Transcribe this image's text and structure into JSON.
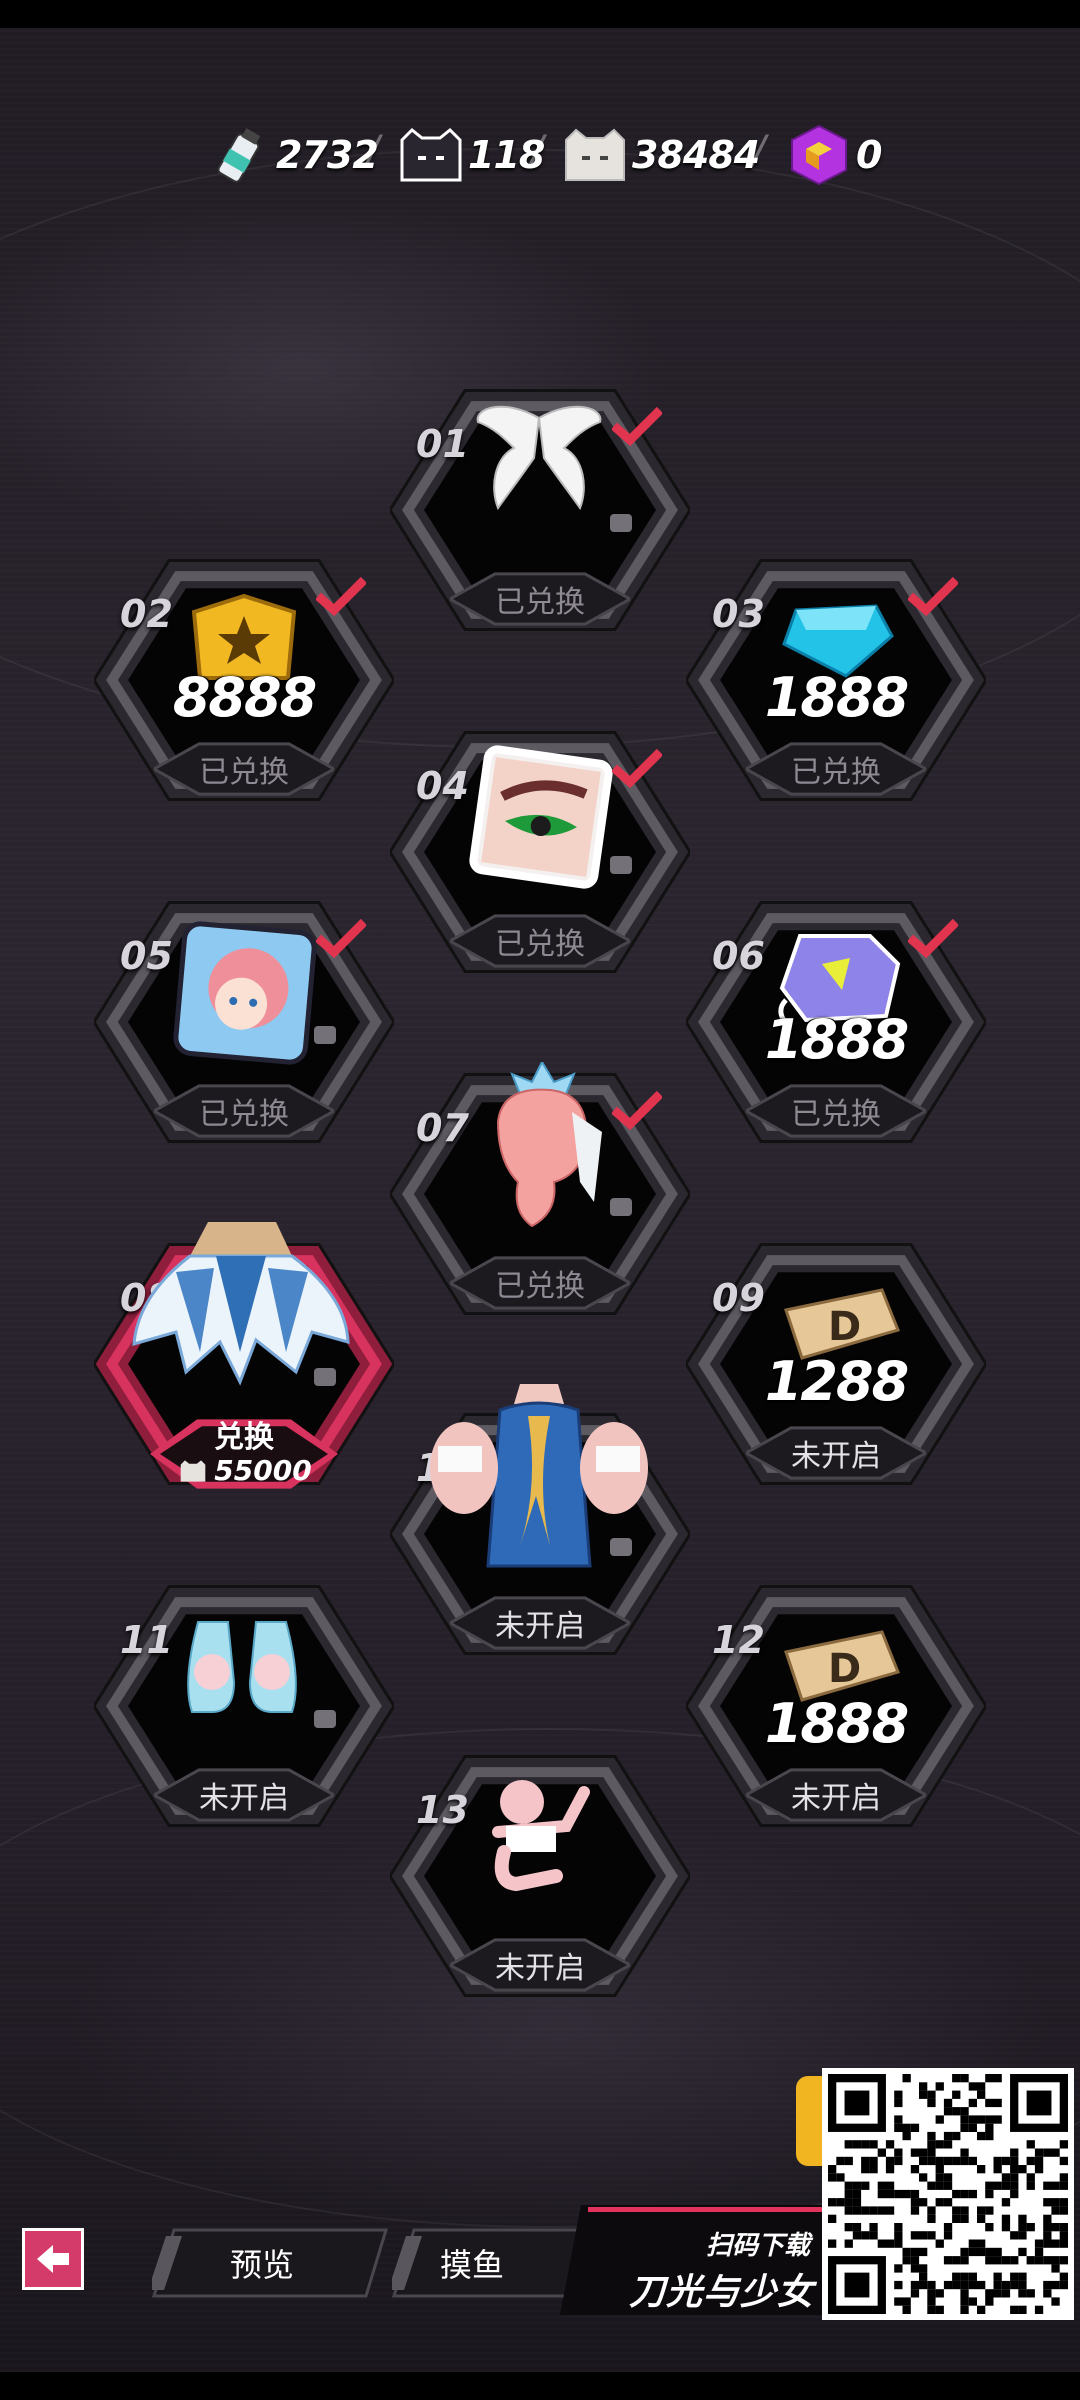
{
  "currencies": [
    {
      "name": "bottle-icon",
      "value": "2732"
    },
    {
      "name": "black-cat-ticket-icon",
      "value": "118"
    },
    {
      "name": "white-cat-ticket-icon",
      "value": "38484"
    },
    {
      "name": "purple-cube-icon",
      "value": "0"
    }
  ],
  "separator": "/",
  "cells": [
    {
      "num": "01",
      "item": "white-wings",
      "status": "已兑换",
      "redeemed": true
    },
    {
      "num": "02",
      "item": "gold-star-badge",
      "amount": "8888",
      "status": "已兑换",
      "redeemed": true
    },
    {
      "num": "03",
      "item": "blue-gem",
      "amount": "1888",
      "status": "已兑换",
      "redeemed": true
    },
    {
      "num": "04",
      "item": "eye-makeup",
      "status": "已兑换",
      "redeemed": true
    },
    {
      "num": "05",
      "item": "avatar-frame",
      "status": "已兑换",
      "redeemed": true
    },
    {
      "num": "06",
      "item": "crystal-ticket",
      "amount": "1888",
      "status": "已兑换",
      "redeemed": true
    },
    {
      "num": "07",
      "item": "pink-hair-crown",
      "status": "已兑换",
      "redeemed": true
    },
    {
      "num": "08",
      "item": "blue-white-skirt",
      "redeem_label": "兑换",
      "redeem_cost": "55000",
      "redeemed": false
    },
    {
      "num": "09",
      "item": "gold-d-tag",
      "amount": "1288",
      "status": "未开启",
      "redeemed": false
    },
    {
      "num": "10",
      "item": "blue-dress-top",
      "status": "未开启",
      "redeemed": false
    },
    {
      "num": "11",
      "item": "light-blue-shoes",
      "status": "未开启",
      "redeemed": false
    },
    {
      "num": "12",
      "item": "gold-d-tag",
      "amount": "1888",
      "status": "未开启",
      "redeemed": false
    },
    {
      "num": "13",
      "item": "pose-action",
      "status": "未开启",
      "redeemed": false
    }
  ],
  "bottom_nav": {
    "tabs": [
      "预览",
      "摸鱼"
    ],
    "qr_caption": "扫码下载",
    "brand_name": "刀光与少女"
  },
  "colors": {
    "accent": "#e2325d",
    "check": "#e0344f",
    "frame": "#5e5a62"
  }
}
